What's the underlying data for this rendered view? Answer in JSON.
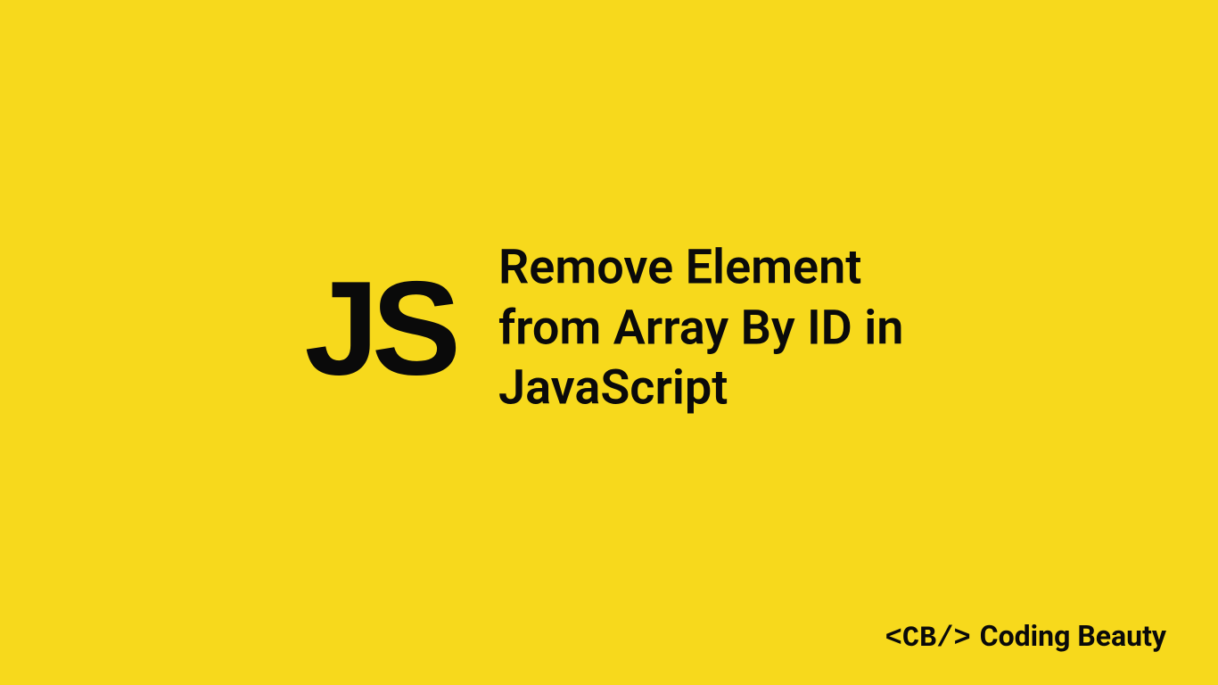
{
  "logo": {
    "text": "JS"
  },
  "title": "Remove Element from Array By ID in JavaScript",
  "brand": {
    "tag": "<CB/>",
    "name": "Coding Beauty"
  }
}
